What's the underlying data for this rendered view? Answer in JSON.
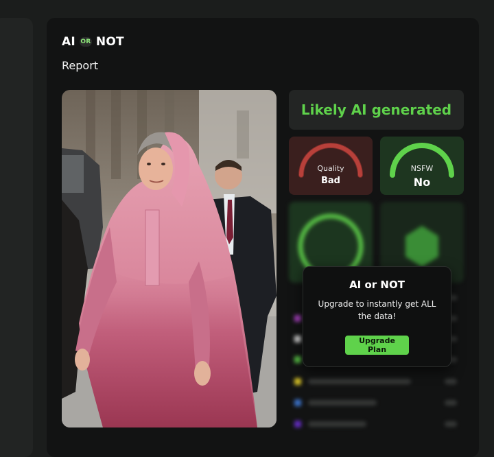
{
  "brand": {
    "logo_left": "AI",
    "logo_middle": "OR",
    "logo_right": "NOT"
  },
  "page": {
    "title": "Report"
  },
  "result": {
    "verdict": "Likely AI generated"
  },
  "gauges": {
    "quality": {
      "label": "Quality",
      "value": "Bad",
      "color": "#b8403a"
    },
    "nsfw": {
      "label": "NSFW",
      "value": "No",
      "color": "#5fd24b"
    }
  },
  "popup": {
    "title": "AI or NOT",
    "message": "Upgrade to instantly get ALL the data!",
    "button": "Upgrade Plan"
  },
  "colors": {
    "accent": "#5fd24b",
    "card": "#121313",
    "background": "#1b1d1c"
  }
}
